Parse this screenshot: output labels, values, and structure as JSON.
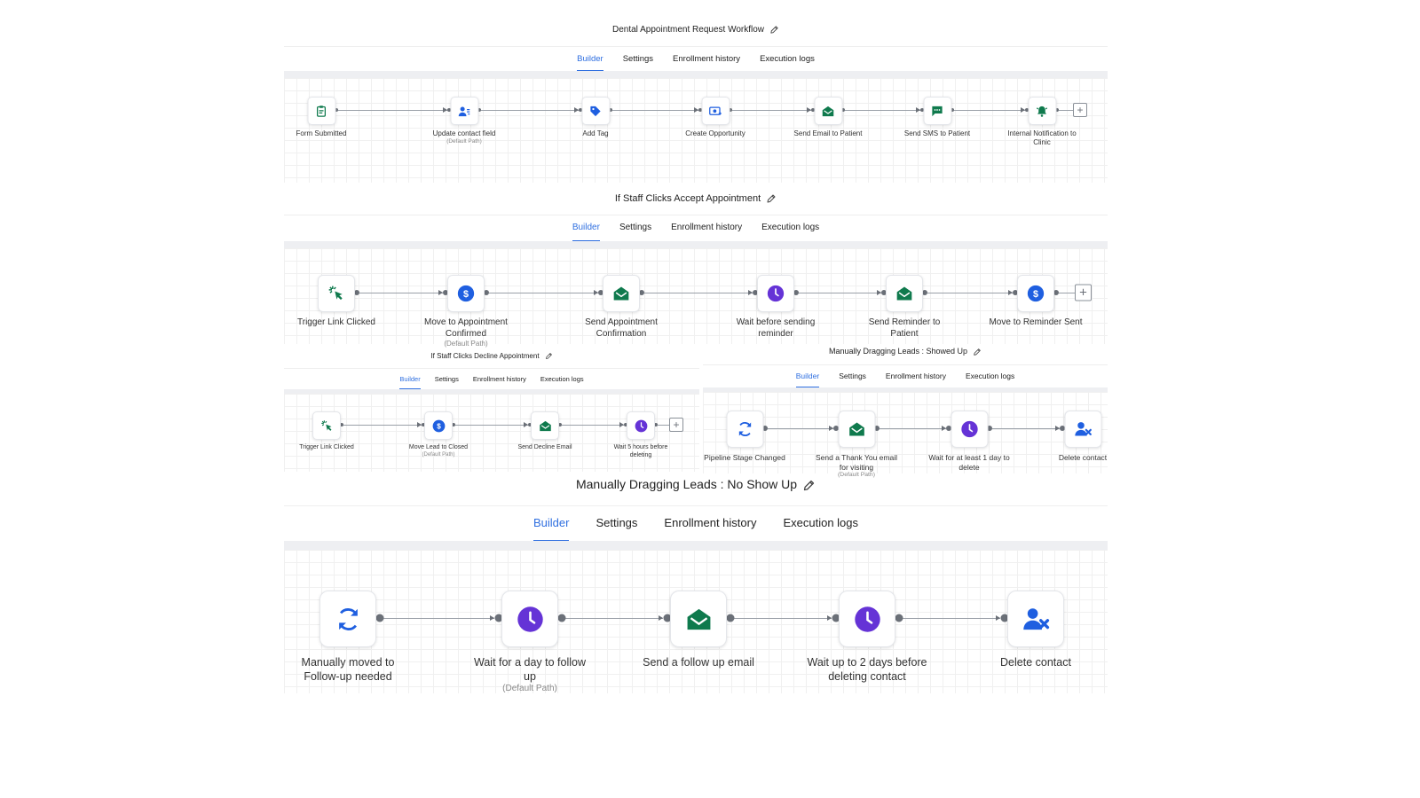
{
  "colors": {
    "accent": "#2f6fe0",
    "green": "#0f7a4d",
    "blue": "#1f5fe0",
    "purple": "#6533d6"
  },
  "workflows": [
    {
      "title": "Dental Appointment Request Workflow",
      "tabs": [
        "Builder",
        "Settings",
        "Enrollment history",
        "Execution logs"
      ],
      "active_tab": "Builder",
      "steps": [
        {
          "label": "Form Submitted",
          "icon": "clipboard-icon"
        },
        {
          "label": "Update contact field",
          "sub": "(Default Path)",
          "icon": "user-edit-icon"
        },
        {
          "label": "Add Tag",
          "icon": "tag-icon"
        },
        {
          "label": "Create Opportunity",
          "icon": "opportunity-icon"
        },
        {
          "label": "Send Email to Patient",
          "icon": "mail-icon"
        },
        {
          "label": "Send SMS to Patient",
          "icon": "sms-icon"
        },
        {
          "label": "Internal Notification to Clinic",
          "icon": "bell-icon"
        }
      ]
    },
    {
      "title": "If Staff Clicks Accept Appointment",
      "tabs": [
        "Builder",
        "Settings",
        "Enrollment history",
        "Execution logs"
      ],
      "active_tab": "Builder",
      "steps": [
        {
          "label": "Trigger Link Clicked",
          "icon": "cursor-click-icon"
        },
        {
          "label": "Move to Appointment Confirmed",
          "sub": "(Default Path)",
          "icon": "dollar-icon"
        },
        {
          "label": "Send Appointment Confirmation",
          "icon": "mail-icon"
        },
        {
          "label": "Wait before sending reminder",
          "icon": "clock-icon"
        },
        {
          "label": "Send Reminder to Patient",
          "icon": "mail-icon"
        },
        {
          "label": "Move to Reminder Sent",
          "icon": "dollar-icon"
        }
      ]
    },
    {
      "title": "If Staff Clicks Decline Appointment",
      "tabs": [
        "Builder",
        "Settings",
        "Enrollment history",
        "Execution logs"
      ],
      "active_tab": "Builder",
      "steps": [
        {
          "label": "Trigger Link Clicked",
          "icon": "cursor-click-icon"
        },
        {
          "label": "Move Lead to Closed",
          "sub": "(Default Path)",
          "icon": "dollar-icon"
        },
        {
          "label": "Send Decline Email",
          "icon": "mail-icon"
        },
        {
          "label": "Wait 5 hours before deleting",
          "icon": "clock-icon"
        }
      ]
    },
    {
      "title": "Manually Dragging Leads : Showed Up",
      "tabs": [
        "Builder",
        "Settings",
        "Enrollment history",
        "Execution logs"
      ],
      "active_tab": "Builder",
      "steps": [
        {
          "label": "Pipeline Stage Changed",
          "icon": "refresh-icon"
        },
        {
          "label": "Send a Thank You email for visiting",
          "sub": "(Default Path)",
          "icon": "mail-icon"
        },
        {
          "label": "Wait for at least 1 day to delete",
          "icon": "clock-icon"
        },
        {
          "label": "Delete contact",
          "icon": "user-delete-icon"
        }
      ]
    },
    {
      "title": "Manually Dragging Leads : No Show Up",
      "tabs": [
        "Builder",
        "Settings",
        "Enrollment history",
        "Execution logs"
      ],
      "active_tab": "Builder",
      "steps": [
        {
          "label": "Manually moved to Follow-up needed",
          "icon": "refresh-icon"
        },
        {
          "label": "Wait for a day to follow up",
          "sub": "(Default Path)",
          "icon": "clock-icon"
        },
        {
          "label": "Send a follow up email",
          "icon": "mail-icon"
        },
        {
          "label": "Wait up to 2 days before deleting contact",
          "icon": "clock-icon"
        },
        {
          "label": "Delete contact",
          "icon": "user-delete-icon"
        }
      ]
    }
  ]
}
